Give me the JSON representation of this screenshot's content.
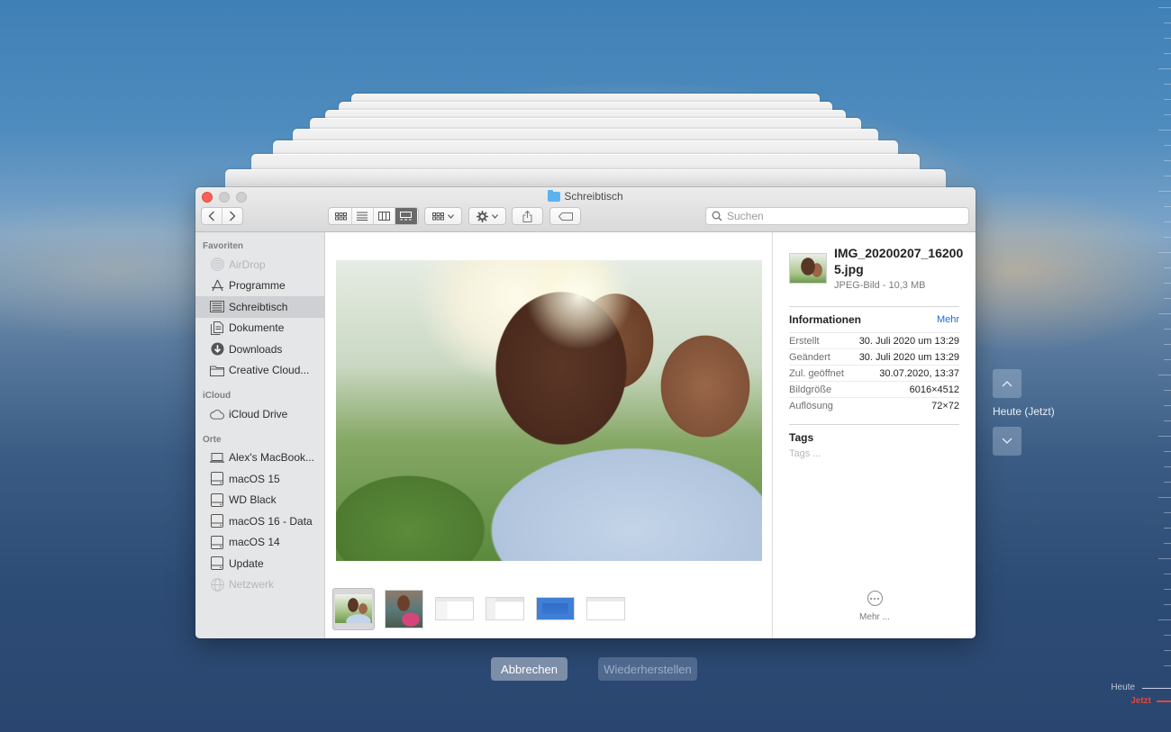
{
  "window": {
    "title": "Schreibtisch"
  },
  "toolbar": {
    "search_placeholder": "Suchen"
  },
  "sidebar": {
    "sections": [
      {
        "heading": "Favoriten",
        "items": [
          {
            "label": "AirDrop",
            "icon": "airdrop-icon"
          },
          {
            "label": "Programme",
            "icon": "applications-icon"
          },
          {
            "label": "Schreibtisch",
            "icon": "desktop-icon"
          },
          {
            "label": "Dokumente",
            "icon": "documents-icon"
          },
          {
            "label": "Downloads",
            "icon": "downloads-icon"
          },
          {
            "label": "Creative Cloud...",
            "icon": "folder-icon"
          }
        ]
      },
      {
        "heading": "iCloud",
        "items": [
          {
            "label": "iCloud Drive",
            "icon": "cloud-icon"
          }
        ]
      },
      {
        "heading": "Orte",
        "items": [
          {
            "label": "Alex's MacBook...",
            "icon": "laptop-icon"
          },
          {
            "label": "macOS 15",
            "icon": "disk-icon"
          },
          {
            "label": "WD Black",
            "icon": "disk-icon"
          },
          {
            "label": "macOS 16 - Data",
            "icon": "disk-icon"
          },
          {
            "label": "macOS 14",
            "icon": "disk-icon"
          },
          {
            "label": "Update",
            "icon": "disk-icon"
          },
          {
            "label": "Netzwerk",
            "icon": "network-icon"
          }
        ]
      }
    ]
  },
  "inspector": {
    "file_name": "IMG_20200207_162005.jpg",
    "file_type": "JPEG-Bild - 10,3 MB",
    "info_title": "Informationen",
    "more_link": "Mehr",
    "info_rows": [
      {
        "key": "Erstellt",
        "value": "30. Juli 2020 um 13:29"
      },
      {
        "key": "Geändert",
        "value": "30. Juli 2020 um 13:29"
      },
      {
        "key": "Zul. geöffnet",
        "value": "30.07.2020, 13:37"
      },
      {
        "key": "Bildgröße",
        "value": "6016×4512"
      },
      {
        "key": "Auflösung",
        "value": "72×72"
      }
    ],
    "tags_title": "Tags",
    "tags_placeholder": "Tags ...",
    "more_bottom": "Mehr ..."
  },
  "timemachine": {
    "current_label": "Heute (Jetzt)",
    "cancel_button": "Abbrechen",
    "restore_button": "Wiederherstellen",
    "timeline_today": "Heute",
    "timeline_now": "Jetzt"
  },
  "colors": {
    "accent": "#1a6fe0",
    "close": "#fc5f57",
    "now_marker": "#e2463a"
  }
}
